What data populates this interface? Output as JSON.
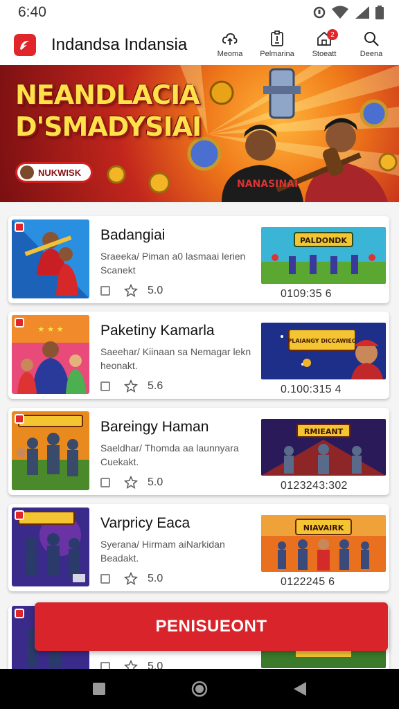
{
  "status_bar": {
    "time": "6:40"
  },
  "app_bar": {
    "title": "Indandsa Indansia",
    "actions": [
      {
        "label": "Meoma",
        "icon": "cloud-sync-icon"
      },
      {
        "label": "Pelmarina",
        "icon": "clipboard-icon"
      },
      {
        "label": "Stoeatt",
        "icon": "home-icon",
        "badge": "2"
      },
      {
        "label": "Deena",
        "icon": "search-icon"
      }
    ]
  },
  "hero": {
    "title_line1": "NEANDLACIA",
    "title_line2": "D'SMADYSIAI",
    "chip_label": "NUKWISK",
    "artwork_text": "NANASINAI"
  },
  "games": [
    {
      "title": "Badangiai",
      "desc": "Sraeeka/ Piman a0 lasmaai lerien Scanekt",
      "rating": "5.0",
      "promo_banner": "PALDONDK",
      "promo_code": "0109:35 6"
    },
    {
      "title": "Paketiny Kamarla",
      "desc": "Saeehar/ Kiinaan sa Nemagar lekn heonakt.",
      "rating": "5.6",
      "promo_banner": "PLAIANGY DICCAWIEO",
      "promo_code": "0.100:315 4"
    },
    {
      "title": "Bareingy Haman",
      "desc": "Saeldhar/ Thomda aa launnyara Cuekakt.",
      "rating": "5.0",
      "promo_banner": "RMIEANT",
      "promo_code": "0123243:302"
    },
    {
      "title": "Varpricy Eaca",
      "desc": "Syerana/ Hirmam aiNarkidan Beadakt.",
      "rating": "5.0",
      "promo_banner": "NIAVAIRK",
      "promo_code": "0122245 6"
    },
    {
      "title": "",
      "desc": "",
      "rating": "5.0",
      "promo_banner": "",
      "promo_code": ""
    }
  ],
  "cta": {
    "label": "PENISUEONT"
  },
  "colors": {
    "accent": "#d8242a",
    "brand": "#e0262a"
  }
}
